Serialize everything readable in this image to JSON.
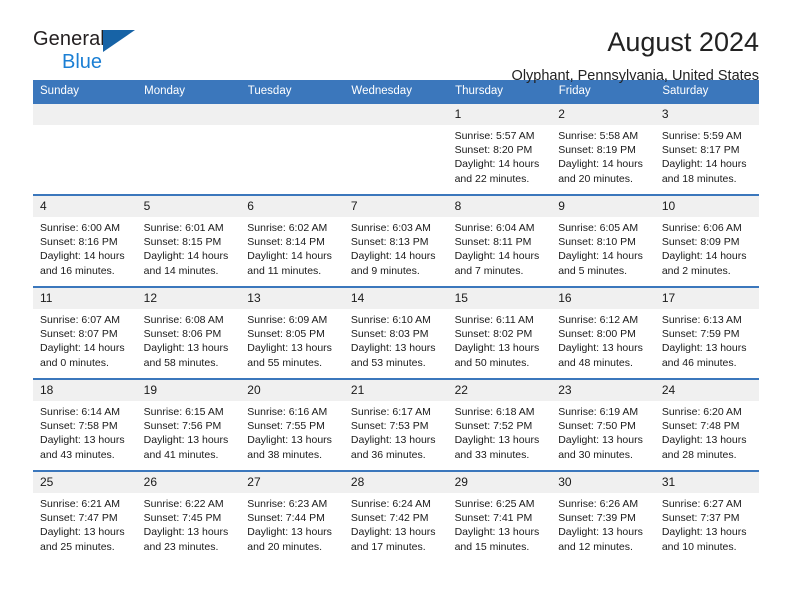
{
  "brand": {
    "name_line1": "General",
    "name_line2": "Blue",
    "triangle_icon": "triangle-icon"
  },
  "header": {
    "title": "August 2024",
    "location": "Olyphant, Pennsylvania, United States"
  },
  "colors": {
    "header_blue": "#3b77bc",
    "brand_blue": "#1b7fd4",
    "daynum_band": "#f0f0f0",
    "text": "#1a1a1a"
  },
  "weekday_headers": [
    "Sunday",
    "Monday",
    "Tuesday",
    "Wednesday",
    "Thursday",
    "Friday",
    "Saturday"
  ],
  "labels": {
    "sunrise_prefix": "Sunrise:",
    "sunset_prefix": "Sunset:",
    "daylight_prefix": "Daylight:"
  },
  "weeks": [
    [
      {
        "day": "",
        "empty": true
      },
      {
        "day": "",
        "empty": true
      },
      {
        "day": "",
        "empty": true
      },
      {
        "day": "",
        "empty": true
      },
      {
        "day": "1",
        "sunrise": "Sunrise: 5:57 AM",
        "sunset": "Sunset: 8:20 PM",
        "daylight_l1": "Daylight: 14 hours",
        "daylight_l2": "and 22 minutes."
      },
      {
        "day": "2",
        "sunrise": "Sunrise: 5:58 AM",
        "sunset": "Sunset: 8:19 PM",
        "daylight_l1": "Daylight: 14 hours",
        "daylight_l2": "and 20 minutes."
      },
      {
        "day": "3",
        "sunrise": "Sunrise: 5:59 AM",
        "sunset": "Sunset: 8:17 PM",
        "daylight_l1": "Daylight: 14 hours",
        "daylight_l2": "and 18 minutes."
      }
    ],
    [
      {
        "day": "4",
        "sunrise": "Sunrise: 6:00 AM",
        "sunset": "Sunset: 8:16 PM",
        "daylight_l1": "Daylight: 14 hours",
        "daylight_l2": "and 16 minutes."
      },
      {
        "day": "5",
        "sunrise": "Sunrise: 6:01 AM",
        "sunset": "Sunset: 8:15 PM",
        "daylight_l1": "Daylight: 14 hours",
        "daylight_l2": "and 14 minutes."
      },
      {
        "day": "6",
        "sunrise": "Sunrise: 6:02 AM",
        "sunset": "Sunset: 8:14 PM",
        "daylight_l1": "Daylight: 14 hours",
        "daylight_l2": "and 11 minutes."
      },
      {
        "day": "7",
        "sunrise": "Sunrise: 6:03 AM",
        "sunset": "Sunset: 8:13 PM",
        "daylight_l1": "Daylight: 14 hours",
        "daylight_l2": "and 9 minutes."
      },
      {
        "day": "8",
        "sunrise": "Sunrise: 6:04 AM",
        "sunset": "Sunset: 8:11 PM",
        "daylight_l1": "Daylight: 14 hours",
        "daylight_l2": "and 7 minutes."
      },
      {
        "day": "9",
        "sunrise": "Sunrise: 6:05 AM",
        "sunset": "Sunset: 8:10 PM",
        "daylight_l1": "Daylight: 14 hours",
        "daylight_l2": "and 5 minutes."
      },
      {
        "day": "10",
        "sunrise": "Sunrise: 6:06 AM",
        "sunset": "Sunset: 8:09 PM",
        "daylight_l1": "Daylight: 14 hours",
        "daylight_l2": "and 2 minutes."
      }
    ],
    [
      {
        "day": "11",
        "sunrise": "Sunrise: 6:07 AM",
        "sunset": "Sunset: 8:07 PM",
        "daylight_l1": "Daylight: 14 hours",
        "daylight_l2": "and 0 minutes."
      },
      {
        "day": "12",
        "sunrise": "Sunrise: 6:08 AM",
        "sunset": "Sunset: 8:06 PM",
        "daylight_l1": "Daylight: 13 hours",
        "daylight_l2": "and 58 minutes."
      },
      {
        "day": "13",
        "sunrise": "Sunrise: 6:09 AM",
        "sunset": "Sunset: 8:05 PM",
        "daylight_l1": "Daylight: 13 hours",
        "daylight_l2": "and 55 minutes."
      },
      {
        "day": "14",
        "sunrise": "Sunrise: 6:10 AM",
        "sunset": "Sunset: 8:03 PM",
        "daylight_l1": "Daylight: 13 hours",
        "daylight_l2": "and 53 minutes."
      },
      {
        "day": "15",
        "sunrise": "Sunrise: 6:11 AM",
        "sunset": "Sunset: 8:02 PM",
        "daylight_l1": "Daylight: 13 hours",
        "daylight_l2": "and 50 minutes."
      },
      {
        "day": "16",
        "sunrise": "Sunrise: 6:12 AM",
        "sunset": "Sunset: 8:00 PM",
        "daylight_l1": "Daylight: 13 hours",
        "daylight_l2": "and 48 minutes."
      },
      {
        "day": "17",
        "sunrise": "Sunrise: 6:13 AM",
        "sunset": "Sunset: 7:59 PM",
        "daylight_l1": "Daylight: 13 hours",
        "daylight_l2": "and 46 minutes."
      }
    ],
    [
      {
        "day": "18",
        "sunrise": "Sunrise: 6:14 AM",
        "sunset": "Sunset: 7:58 PM",
        "daylight_l1": "Daylight: 13 hours",
        "daylight_l2": "and 43 minutes."
      },
      {
        "day": "19",
        "sunrise": "Sunrise: 6:15 AM",
        "sunset": "Sunset: 7:56 PM",
        "daylight_l1": "Daylight: 13 hours",
        "daylight_l2": "and 41 minutes."
      },
      {
        "day": "20",
        "sunrise": "Sunrise: 6:16 AM",
        "sunset": "Sunset: 7:55 PM",
        "daylight_l1": "Daylight: 13 hours",
        "daylight_l2": "and 38 minutes."
      },
      {
        "day": "21",
        "sunrise": "Sunrise: 6:17 AM",
        "sunset": "Sunset: 7:53 PM",
        "daylight_l1": "Daylight: 13 hours",
        "daylight_l2": "and 36 minutes."
      },
      {
        "day": "22",
        "sunrise": "Sunrise: 6:18 AM",
        "sunset": "Sunset: 7:52 PM",
        "daylight_l1": "Daylight: 13 hours",
        "daylight_l2": "and 33 minutes."
      },
      {
        "day": "23",
        "sunrise": "Sunrise: 6:19 AM",
        "sunset": "Sunset: 7:50 PM",
        "daylight_l1": "Daylight: 13 hours",
        "daylight_l2": "and 30 minutes."
      },
      {
        "day": "24",
        "sunrise": "Sunrise: 6:20 AM",
        "sunset": "Sunset: 7:48 PM",
        "daylight_l1": "Daylight: 13 hours",
        "daylight_l2": "and 28 minutes."
      }
    ],
    [
      {
        "day": "25",
        "sunrise": "Sunrise: 6:21 AM",
        "sunset": "Sunset: 7:47 PM",
        "daylight_l1": "Daylight: 13 hours",
        "daylight_l2": "and 25 minutes."
      },
      {
        "day": "26",
        "sunrise": "Sunrise: 6:22 AM",
        "sunset": "Sunset: 7:45 PM",
        "daylight_l1": "Daylight: 13 hours",
        "daylight_l2": "and 23 minutes."
      },
      {
        "day": "27",
        "sunrise": "Sunrise: 6:23 AM",
        "sunset": "Sunset: 7:44 PM",
        "daylight_l1": "Daylight: 13 hours",
        "daylight_l2": "and 20 minutes."
      },
      {
        "day": "28",
        "sunrise": "Sunrise: 6:24 AM",
        "sunset": "Sunset: 7:42 PM",
        "daylight_l1": "Daylight: 13 hours",
        "daylight_l2": "and 17 minutes."
      },
      {
        "day": "29",
        "sunrise": "Sunrise: 6:25 AM",
        "sunset": "Sunset: 7:41 PM",
        "daylight_l1": "Daylight: 13 hours",
        "daylight_l2": "and 15 minutes."
      },
      {
        "day": "30",
        "sunrise": "Sunrise: 6:26 AM",
        "sunset": "Sunset: 7:39 PM",
        "daylight_l1": "Daylight: 13 hours",
        "daylight_l2": "and 12 minutes."
      },
      {
        "day": "31",
        "sunrise": "Sunrise: 6:27 AM",
        "sunset": "Sunset: 7:37 PM",
        "daylight_l1": "Daylight: 13 hours",
        "daylight_l2": "and 10 minutes."
      }
    ]
  ]
}
